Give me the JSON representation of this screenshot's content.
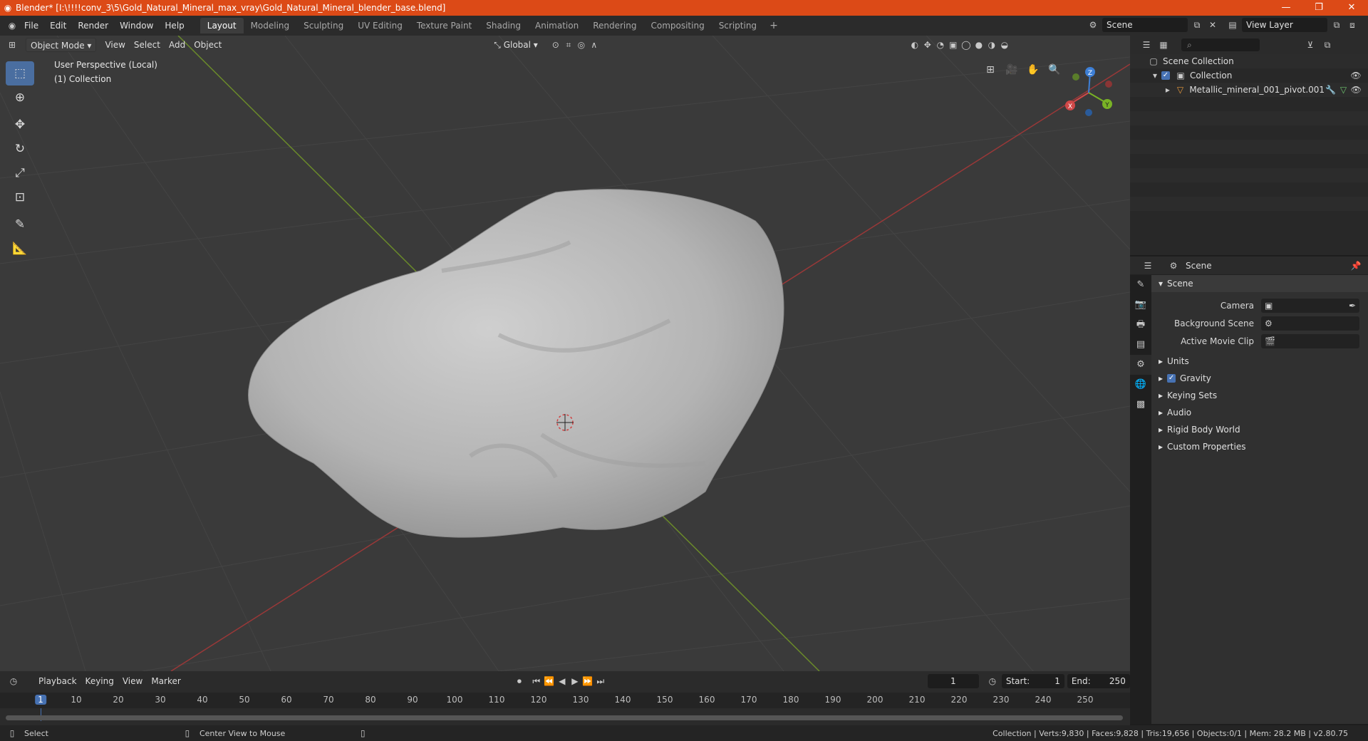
{
  "window": {
    "title": "Blender* [I:\\!!!!conv_3\\5\\Gold_Natural_Mineral_max_vray\\Gold_Natural_Mineral_blender_base.blend]",
    "controls": [
      "—",
      "❐",
      "✕"
    ]
  },
  "menu": [
    "File",
    "Edit",
    "Render",
    "Window",
    "Help"
  ],
  "workspaces": [
    "Layout",
    "Modeling",
    "Sculpting",
    "UV Editing",
    "Texture Paint",
    "Shading",
    "Animation",
    "Rendering",
    "Compositing",
    "Scripting"
  ],
  "active_workspace": "Layout",
  "scene_field": "Scene",
  "view_layer_field": "View Layer",
  "viewport": {
    "mode": "Object Mode",
    "menus": [
      "View",
      "Select",
      "Add",
      "Object"
    ],
    "orientation": "Global",
    "perspective_label": "User Perspective (Local)",
    "collection_label": "(1) Collection",
    "gizmo_axes": {
      "x": "X",
      "y": "Y",
      "z": "Z"
    }
  },
  "outliner": {
    "root": "Scene Collection",
    "collection": "Collection",
    "object": "Metallic_mineral_001_pivot.001"
  },
  "properties": {
    "header": "Scene",
    "panel": "Scene",
    "camera_label": "Camera",
    "bg_scene_label": "Background Scene",
    "movie_clip_label": "Active Movie Clip",
    "sections": [
      "Units",
      "Gravity",
      "Keying Sets",
      "Audio",
      "Rigid Body World",
      "Custom Properties"
    ],
    "gravity_checked": true
  },
  "timeline": {
    "menus": [
      "Playback",
      "Keying",
      "View",
      "Marker"
    ],
    "current_frame": "1",
    "start_label": "Start:",
    "start": "1",
    "end_label": "End:",
    "end": "250",
    "ruler": [
      "1",
      "10",
      "20",
      "30",
      "40",
      "50",
      "60",
      "70",
      "80",
      "90",
      "100",
      "110",
      "120",
      "130",
      "140",
      "150",
      "160",
      "170",
      "180",
      "190",
      "200",
      "210",
      "220",
      "230",
      "240",
      "250"
    ]
  },
  "status": {
    "left": "Select",
    "middle": "Center View to Mouse",
    "right": "Collection | Verts:9,830 | Faces:9,828 | Tris:19,656 | Objects:0/1 | Mem: 28.2 MB | v2.80.75"
  }
}
